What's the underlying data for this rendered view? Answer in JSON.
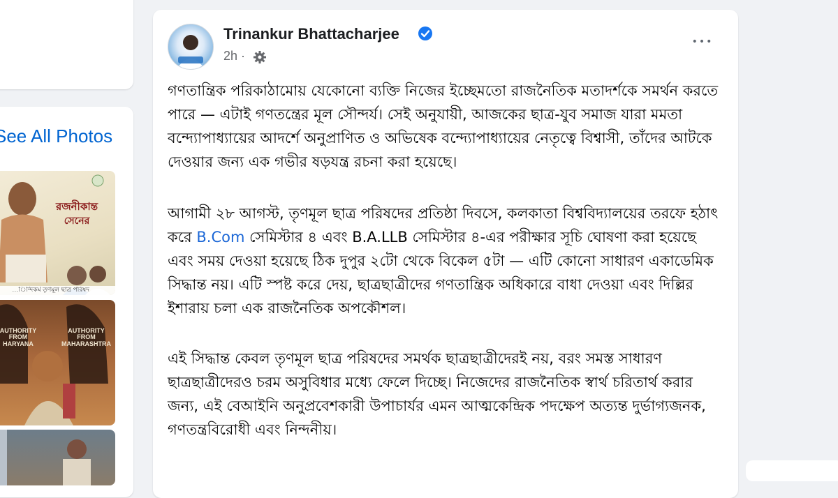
{
  "left_column": {
    "see_all_photos": "See All Photos",
    "photo_1_text": {
      "line_a": "রজনীকান্ত",
      "line_b": "সেনের",
      "footer": "…িন্দিকর্ম তৃণমূল ছাত্র পরিষদ"
    },
    "photo_2_text": {
      "left_sign": "AUTHORITY FROM HARYANA",
      "right_sign": "AUTHORITY FROM MAHARASHTRA"
    }
  },
  "post": {
    "author": "Trinankur Bhattacharjee",
    "timestamp": "2h",
    "separator": "·",
    "more_label": "•••",
    "paragraphs": {
      "p1": "গণতান্ত্রিক পরিকাঠামোয় যেকোনো ব্যক্তি নিজের ইচ্ছেমতো রাজনৈতিক মতাদর্শকে সমর্থন করতে পারে — এটাই গণতন্ত্রের মূল সৌন্দর্য। সেই অনুযায়ী, আজকের ছাত্র-যুব সমাজ যারা মমতা বন্দ্যোপাধ্যায়ের আদর্শে অনুপ্রাণিত ও অভিষেক বন্দ্যোপাধ্যায়ের নেতৃত্বে বিশ্বাসী, তাঁদের আটকে দেওয়ার জন্য এক গভীর ষড়যন্ত্র রচনা করা হয়েছে।",
      "p2_before": "আগামী ২৮ আগস্ট, তৃণমূল ছাত্র পরিষদের প্রতিষ্ঠা দিবসে, কলকাতা বিশ্ববিদ্যালয়ের তরফে হঠাৎ করে ",
      "p2_link": "B.Com",
      "p2_after": " সেমিস্টার ৪ এবং B.A.LLB সেমিস্টার ৪-এর পরীক্ষার সূচি ঘোষণা করা হয়েছে এবং সময় দেওয়া হয়েছে ঠিক দুপুর ২টো থেকে বিকেল ৫টা — এটি কোনো সাধারণ একাডেমিক সিদ্ধান্ত নয়। এটি স্পষ্ট করে দেয়, ছাত্রছাত্রীদের গণতান্ত্রিক অধিকারে বাধা দেওয়া এবং দিল্লির ইশারায় চলা এক রাজনৈতিক অপকৌশল।",
      "p3": "এই সিদ্ধান্ত কেবল তৃণমূল ছাত্র পরিষদের সমর্থক ছাত্রছাত্রীদেরই নয়, বরং সমস্ত সাধারণ ছাত্রছাত্রীদেরও চরম অসুবিধার মধ্যে ফেলে দিচ্ছে। নিজেদের রাজনৈতিক স্বার্থ চরিতার্থ করার জন্য, এই বেআইনি অনুপ্রবেশকারী উপাচার্যর এমন আত্মকেন্দ্রিক পদক্ষেপ অত্যন্ত দুর্ভাগ্যজনক, গণতন্ত্রবিরোধী এবং নিন্দনীয়।"
    }
  },
  "colors": {
    "link": "#1a66d6",
    "see_all": "#0064d1",
    "verified": "#1877f2",
    "background": "#f0f2f5"
  },
  "icons": {
    "verified": "verified-badge-icon",
    "audience": "gear-icon",
    "more": "more-options-icon"
  }
}
